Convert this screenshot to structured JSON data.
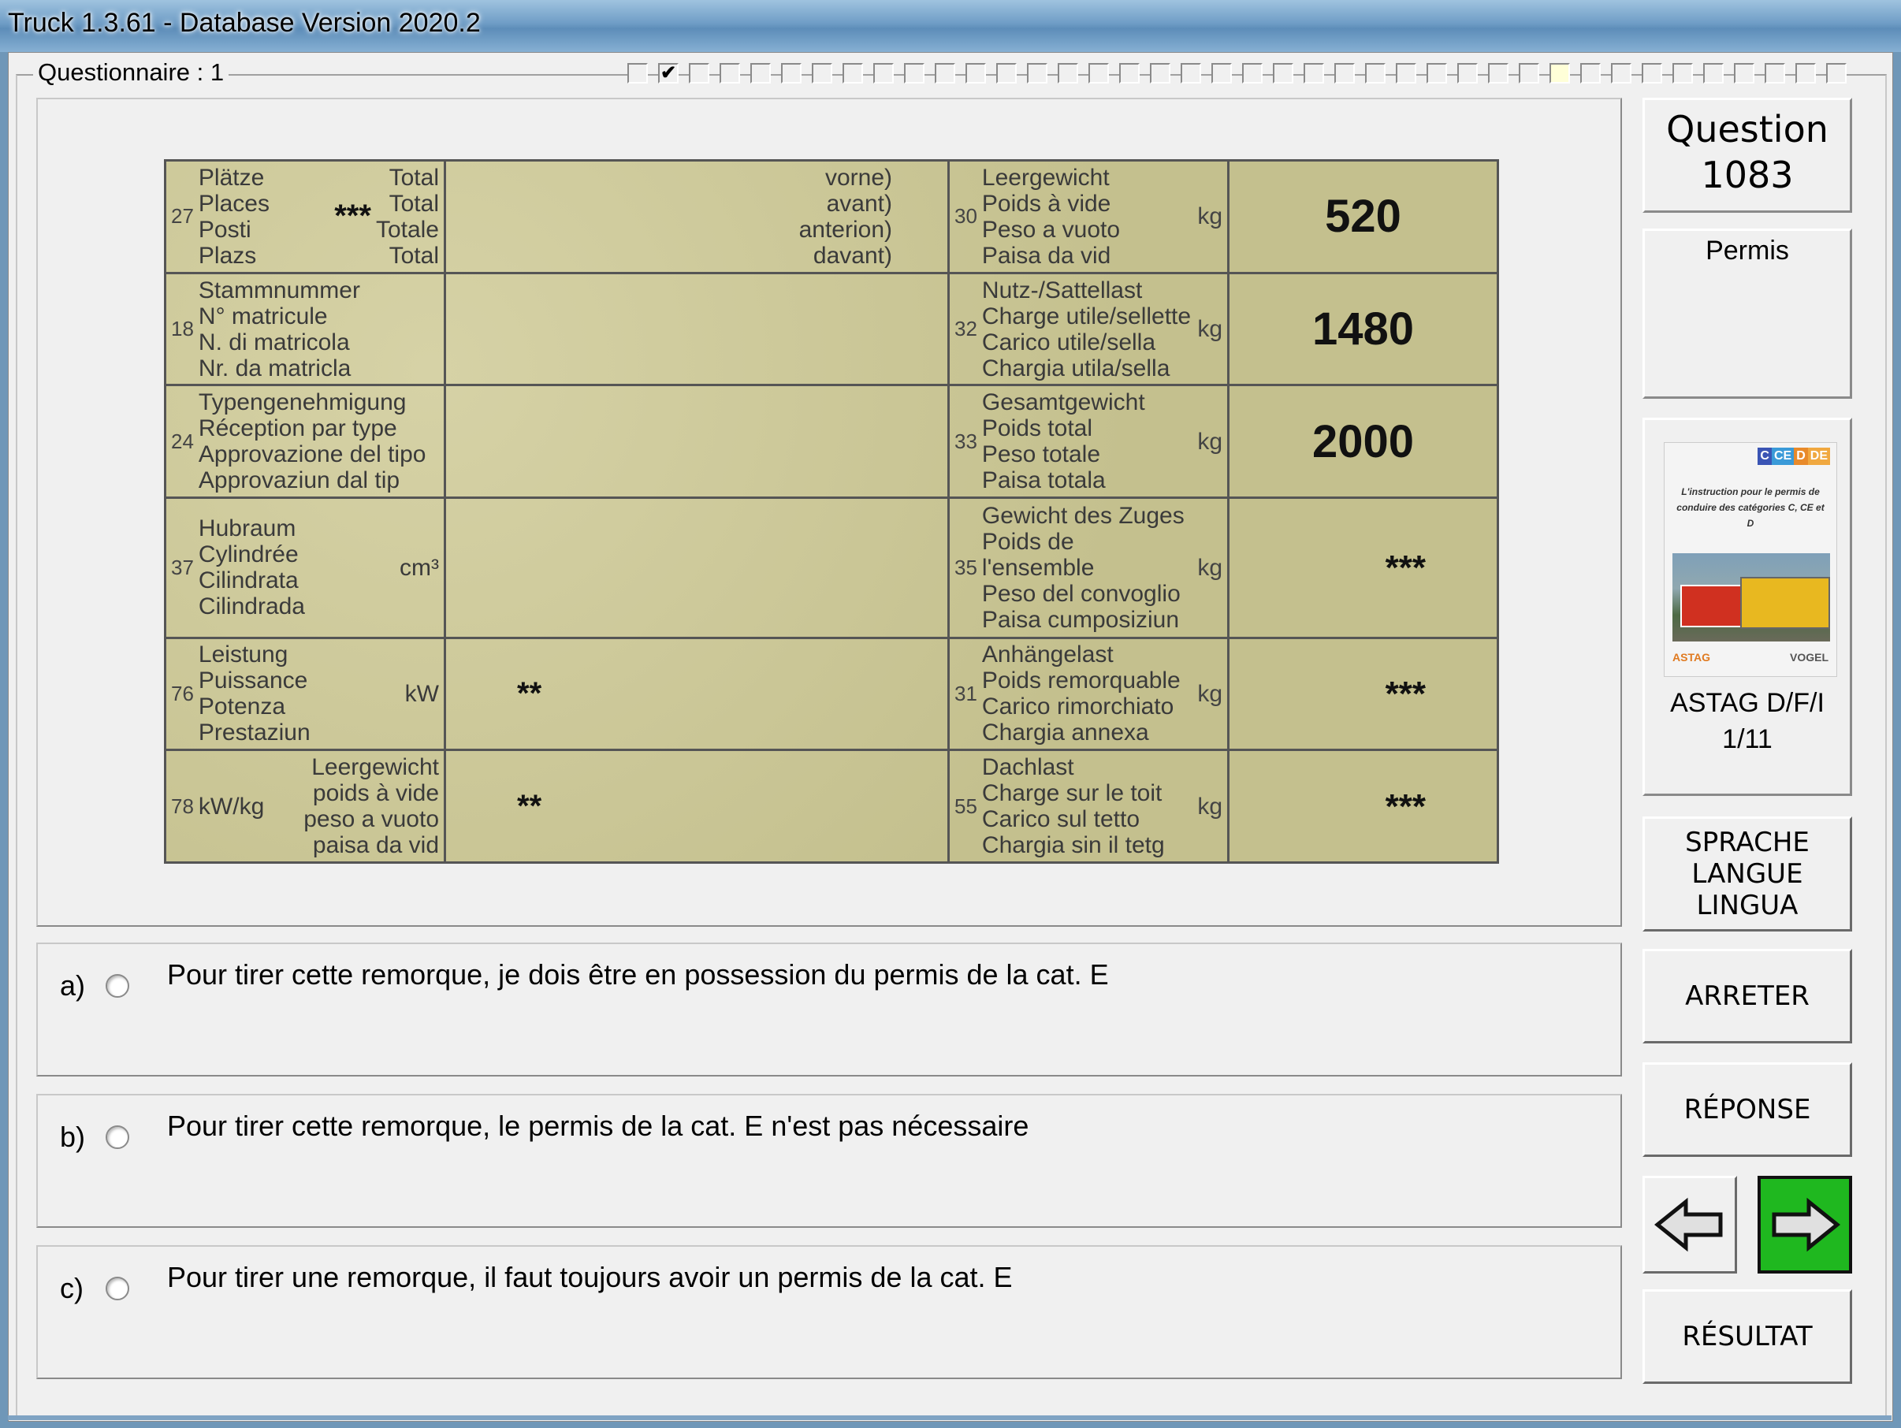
{
  "window": {
    "title": "Truck 1.3.61 - Database Version 2020.2"
  },
  "questionnaire": {
    "label": "Questionnaire : 1",
    "boxes": [
      "",
      "✔",
      "",
      "",
      "",
      "",
      "",
      "",
      "",
      "",
      "",
      "",
      "",
      "",
      "",
      "",
      "",
      "",
      "",
      "",
      "",
      "",
      "",
      "",
      "",
      "",
      "",
      "",
      "",
      "",
      "",
      "",
      "",
      "",
      "",
      "",
      "",
      "",
      "",
      ""
    ],
    "current_index": 30
  },
  "document_image": {
    "rows": [
      {
        "num_left": "27",
        "left_lines": "Plätze\nPlaces\nPosti\nPlazs",
        "left_extra": "Total\nTotal\nTotale\nTotal",
        "left_mark": "***",
        "mid": "vorne)\navant)\nanterion)\ndavant)",
        "num_right": "30",
        "right_lines": "Leergewicht\nPoids à vide\nPeso a vuoto\nPaisa da vid",
        "unit": "kg",
        "value": "520"
      },
      {
        "num_left": "18",
        "left_lines": "Stammnummer\nN° matricule\nN. di matricola\nNr. da matricla",
        "left_extra": "",
        "left_mark": "",
        "mid": "",
        "num_right": "32",
        "right_lines": "Nutz-/Sattellast\nCharge utile/sellette\nCarico utile/sella\nChargia utila/sella",
        "unit": "kg",
        "value": "1480"
      },
      {
        "num_left": "24",
        "left_lines": "Typengenehmigung\nRéception par type\nApprovazione del tipo\nApprovaziun dal tip",
        "left_extra": "",
        "left_mark": "",
        "mid": "",
        "num_right": "33",
        "right_lines": "Gesamtgewicht\nPoids total\nPeso totale\nPaisa totala",
        "unit": "kg",
        "value": "2000"
      },
      {
        "num_left": "37",
        "left_lines": "Hubraum\nCylindrée\nCilindrata\nCilindrada",
        "left_extra": "cm³",
        "left_mark": "",
        "mid": "",
        "num_right": "35",
        "right_lines": "Gewicht des Zuges\nPoids de l'ensemble\nPeso del convoglio\nPaisa cumposiziun",
        "unit": "kg",
        "value": "***"
      },
      {
        "num_left": "76",
        "left_lines": "Leistung\nPuissance\nPotenza\nPrestaziun",
        "left_extra": "kW",
        "left_mark": "",
        "mid": "**",
        "num_right": "31",
        "right_lines": "Anhängelast\nPoids remorquable\nCarico rimorchiato\nChargia annexa",
        "unit": "kg",
        "value": "***"
      },
      {
        "num_left": "78",
        "left_lines": "kW/kg",
        "left_extra": "Leergewicht\npoids à vide\npeso a vuoto\npaisa da vid",
        "left_mark": "",
        "mid": "**",
        "num_right": "55",
        "right_lines": "Dachlast\nCharge sur le toit\nCarico sul tetto\nChargia sin il tetg",
        "unit": "kg",
        "value": "***"
      }
    ]
  },
  "answers": [
    {
      "letter": "a)",
      "text": "Pour tirer cette remorque, je dois être en possession du permis de la cat. E"
    },
    {
      "letter": "b)",
      "text": "Pour tirer cette remorque, le permis de la cat. E n'est pas nécessaire"
    },
    {
      "letter": "c)",
      "text": "Pour tirer une remorque, il faut toujours avoir un permis de la cat. E"
    }
  ],
  "sidebar": {
    "question_label": "Question",
    "question_number": "1083",
    "category": "Permis",
    "book": {
      "cats": [
        "C",
        "CE",
        "D",
        "DE"
      ],
      "cat_colors": [
        "#3a54b4",
        "#3a9ad8",
        "#e88a2a",
        "#f0a840"
      ],
      "cover_text": "L'instruction pour le permis de conduire des catégories C, CE et D",
      "logo_left": "ASTAG",
      "logo_right": "VOGEL",
      "caption_line1": "ASTAG D/F/I",
      "caption_line2": "1/11"
    },
    "buttons": {
      "language": [
        "SPRACHE",
        "LANGUE",
        "LINGUA"
      ],
      "stop": "ARRETER",
      "answer": "RÉPONSE",
      "result": "RÉSULTAT",
      "prev_icon": "arrow-left-icon",
      "next_icon": "arrow-right-icon"
    }
  }
}
